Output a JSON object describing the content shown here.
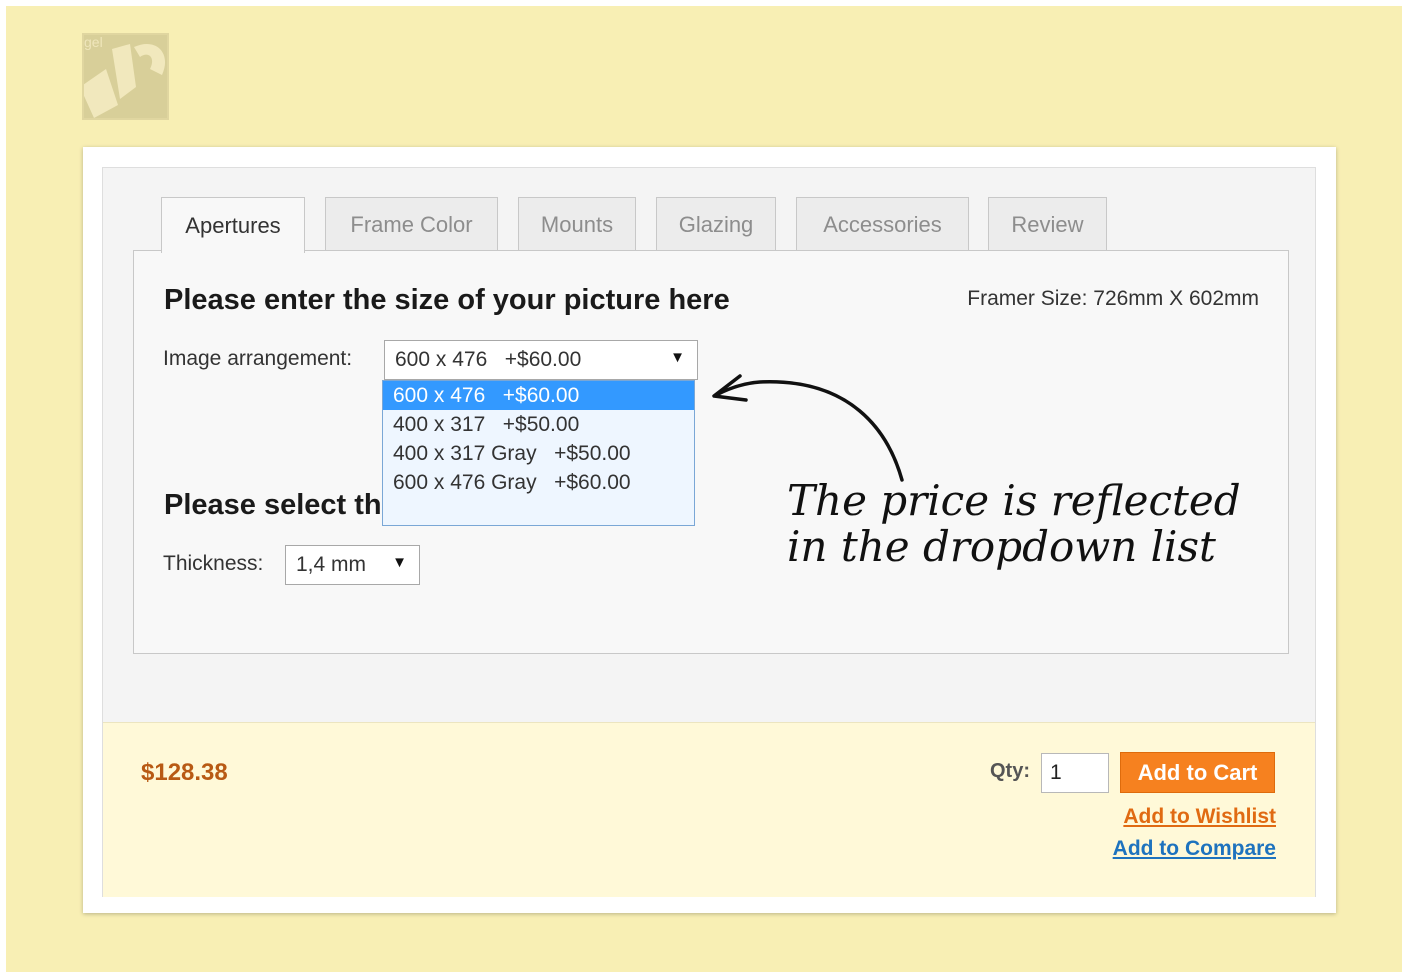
{
  "tabs": [
    {
      "label": "Apertures",
      "active": true
    },
    {
      "label": "Frame Color",
      "active": false
    },
    {
      "label": "Mounts",
      "active": false
    },
    {
      "label": "Glazing",
      "active": false
    },
    {
      "label": "Accessories",
      "active": false
    },
    {
      "label": "Review",
      "active": false
    }
  ],
  "panel": {
    "heading": "Please enter the size of your picture here",
    "framer_size": "Framer Size: 726mm X 602mm",
    "image_arrangement": {
      "label": "Image arrangement:",
      "selected": "600 x 476   +$60.00",
      "options": [
        "600 x 476   +$60.00",
        "400 x 317   +$50.00",
        "400 x 317 Gray   +$50.00",
        "600 x 476 Gray   +$60.00"
      ]
    },
    "heading2": "Please select th",
    "thickness": {
      "label": "Thickness:",
      "selected": "1,4 mm"
    }
  },
  "annotation": {
    "line1": "The price is reflected",
    "line2": "in the dropdown list"
  },
  "footer": {
    "price": "$128.38",
    "qty_label": "Qty:",
    "qty_value": "1",
    "add_to_cart": "Add to Cart",
    "add_to_wishlist": "Add to Wishlist",
    "add_to_compare": "Add to Compare"
  },
  "colors": {
    "accent": "#f6811f",
    "price": "#b85a14",
    "wishlist_link": "#e06a12",
    "compare_link": "#1e73be",
    "selected_option": "#3399ff",
    "backdrop": "#f8efb4"
  },
  "icons": {
    "logo": "brand-logo",
    "dropdown_arrow": "chevron-down-icon",
    "annotation_arrow": "curved-arrow-icon"
  }
}
